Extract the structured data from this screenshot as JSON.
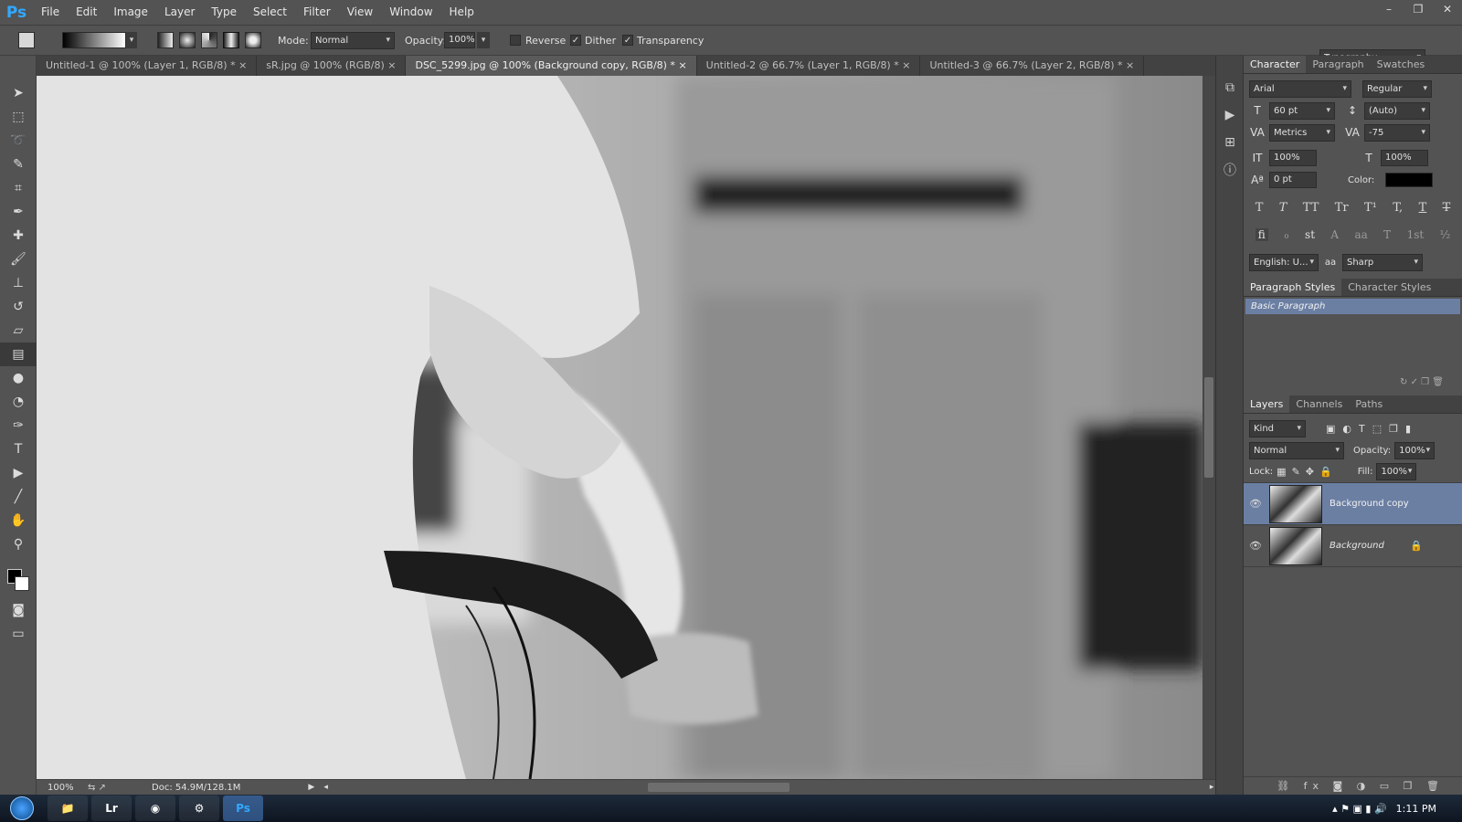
{
  "app": {
    "logo": "Ps"
  },
  "menu": [
    "File",
    "Edit",
    "Image",
    "Layer",
    "Type",
    "Select",
    "Filter",
    "View",
    "Window",
    "Help"
  ],
  "window_controls": [
    "–",
    "❐",
    "✕"
  ],
  "options": {
    "mode_label": "Mode:",
    "mode_value": "Normal",
    "opacity_label": "Opacity:",
    "opacity_value": "100%",
    "reverse_label": "Reverse",
    "dither_label": "Dither",
    "transparency_label": "Transparency",
    "workspace": "Typography"
  },
  "tabs": [
    {
      "label": "Untitled-1 @ 100% (Layer 1, RGB/8) *"
    },
    {
      "label": "sR.jpg @ 100% (RGB/8)"
    },
    {
      "label": "DSC_5299.jpg @ 100% (Background copy, RGB/8) *"
    },
    {
      "label": "Untitled-2 @ 66.7% (Layer 1, RGB/8) *"
    },
    {
      "label": "Untitled-3 @ 66.7% (Layer 2, RGB/8) *"
    }
  ],
  "tab_close": "×",
  "character": {
    "tabs": [
      "Character",
      "Paragraph",
      "Swatches"
    ],
    "font": "Arial",
    "style": "Regular",
    "size": "60 pt",
    "leading": "(Auto)",
    "kerning": "Metrics",
    "tracking": "-75",
    "vscale": "100%",
    "hscale": "100%",
    "baseline": "0 pt",
    "color_label": "Color:",
    "language": "English: U...",
    "aa_label": "aa",
    "antialias": "Sharp",
    "type_buttons": [
      "T",
      "T",
      "TT",
      "Tr",
      "T¹",
      "T,",
      "T",
      "T"
    ],
    "ot_buttons": [
      "fi",
      "ℴ",
      "st",
      "A",
      "aa",
      "T",
      "1st",
      "½"
    ]
  },
  "paragraph_styles": {
    "tabs": [
      "Paragraph Styles",
      "Character Styles"
    ],
    "items": [
      "Basic Paragraph"
    ]
  },
  "layers": {
    "tabs": [
      "Layers",
      "Channels",
      "Paths"
    ],
    "filter": "Kind",
    "blend": "Normal",
    "opacity_label": "Opacity:",
    "opacity": "100%",
    "lock_label": "Lock:",
    "fill_label": "Fill:",
    "fill": "100%",
    "rows": [
      {
        "name": "Background copy"
      },
      {
        "name": "Background"
      }
    ]
  },
  "status": {
    "zoom": "100%",
    "doc": "Doc: 54.9M/128.1M"
  },
  "taskbar": {
    "apps": [
      "Lr",
      "Ps"
    ],
    "time": "1:11 PM"
  }
}
